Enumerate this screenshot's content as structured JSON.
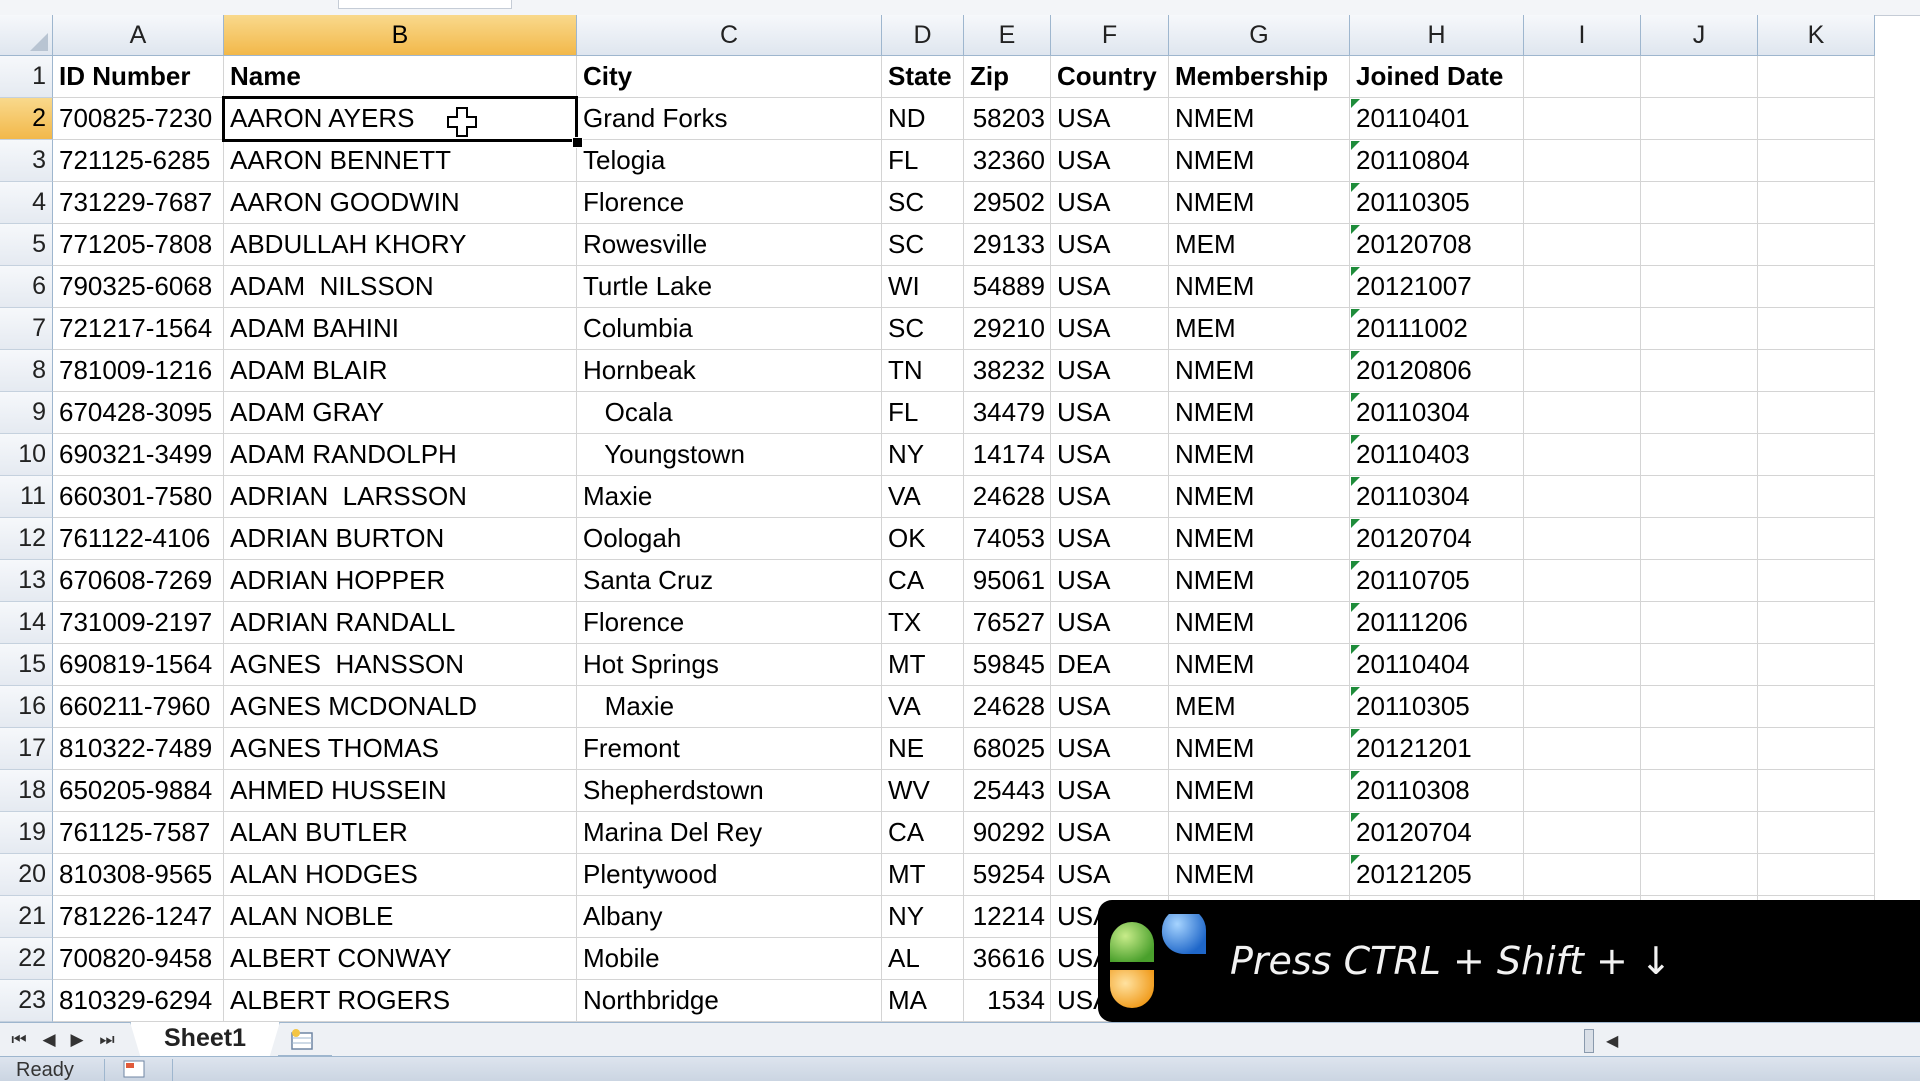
{
  "columns": [
    "A",
    "B",
    "C",
    "D",
    "E",
    "F",
    "G",
    "H",
    "I",
    "J",
    "K"
  ],
  "selected_column": "B",
  "selected_row": "2",
  "header_row": {
    "row_label": "1",
    "cells": [
      "ID Number",
      "Name",
      "City",
      "State",
      "Zip",
      "Country",
      "Membership",
      "Joined Date"
    ]
  },
  "rows": [
    {
      "n": "2",
      "id": "700825-7230",
      "name": "AARON AYERS",
      "city": "Grand Forks",
      "state": "ND",
      "zip": "58203",
      "country": "USA",
      "membership": "NMEM",
      "joined": "20110401"
    },
    {
      "n": "3",
      "id": "721125-6285",
      "name": "AARON BENNETT",
      "city": "Telogia",
      "state": "FL",
      "zip": "32360",
      "country": "USA",
      "membership": "NMEM",
      "joined": "20110804"
    },
    {
      "n": "4",
      "id": "731229-7687",
      "name": "AARON GOODWIN",
      "city": "Florence",
      "state": "SC",
      "zip": "29502",
      "country": "USA",
      "membership": "NMEM",
      "joined": "20110305"
    },
    {
      "n": "5",
      "id": "771205-7808",
      "name": "ABDULLAH KHORY",
      "city": "Rowesville",
      "state": "SC",
      "zip": "29133",
      "country": "USA",
      "membership": "MEM",
      "joined": "20120708"
    },
    {
      "n": "6",
      "id": "790325-6068",
      "name": "ADAM  NILSSON",
      "city": "Turtle Lake",
      "state": "WI",
      "zip": "54889",
      "country": "USA",
      "membership": "NMEM",
      "joined": "20121007"
    },
    {
      "n": "7",
      "id": "721217-1564",
      "name": "ADAM BAHINI",
      "city": "Columbia",
      "state": "SC",
      "zip": "29210",
      "country": "USA",
      "membership": "MEM",
      "joined": "20111002"
    },
    {
      "n": "8",
      "id": "781009-1216",
      "name": "ADAM BLAIR",
      "city": "Hornbeak",
      "state": "TN",
      "zip": "38232",
      "country": "USA",
      "membership": "NMEM",
      "joined": "20120806"
    },
    {
      "n": "9",
      "id": "670428-3095",
      "name": "ADAM GRAY",
      "city": "   Ocala",
      "state": "FL",
      "zip": "34479",
      "country": "USA",
      "membership": "NMEM",
      "joined": "20110304"
    },
    {
      "n": "10",
      "id": "690321-3499",
      "name": "ADAM RANDOLPH",
      "city": "   Youngstown",
      "state": "NY",
      "zip": "14174",
      "country": "USA",
      "membership": "NMEM",
      "joined": "20110403"
    },
    {
      "n": "11",
      "id": "660301-7580",
      "name": "ADRIAN  LARSSON",
      "city": "Maxie",
      "state": "VA",
      "zip": "24628",
      "country": "USA",
      "membership": "NMEM",
      "joined": "20110304"
    },
    {
      "n": "12",
      "id": "761122-4106",
      "name": "ADRIAN BURTON",
      "city": "Oologah",
      "state": "OK",
      "zip": "74053",
      "country": "USA",
      "membership": "NMEM",
      "joined": "20120704"
    },
    {
      "n": "13",
      "id": "670608-7269",
      "name": "ADRIAN HOPPER",
      "city": "Santa Cruz",
      "state": "CA",
      "zip": "95061",
      "country": "USA",
      "membership": "NMEM",
      "joined": "20110705"
    },
    {
      "n": "14",
      "id": "731009-2197",
      "name": "ADRIAN RANDALL",
      "city": "Florence",
      "state": "TX",
      "zip": "76527",
      "country": "USA",
      "membership": "NMEM",
      "joined": "20111206"
    },
    {
      "n": "15",
      "id": "690819-1564",
      "name": "AGNES  HANSSON",
      "city": "Hot Springs",
      "state": "MT",
      "zip": "59845",
      "country": "DEA",
      "membership": "NMEM",
      "joined": "20110404"
    },
    {
      "n": "16",
      "id": "660211-7960",
      "name": "AGNES MCDONALD",
      "city": "   Maxie",
      "state": "VA",
      "zip": "24628",
      "country": "USA",
      "membership": "MEM",
      "joined": "20110305"
    },
    {
      "n": "17",
      "id": "810322-7489",
      "name": "AGNES THOMAS",
      "city": "Fremont",
      "state": "NE",
      "zip": "68025",
      "country": "USA",
      "membership": "NMEM",
      "joined": "20121201"
    },
    {
      "n": "18",
      "id": "650205-9884",
      "name": "AHMED HUSSEIN",
      "city": "Shepherdstown",
      "state": "WV",
      "zip": "25443",
      "country": "USA",
      "membership": "NMEM",
      "joined": "20110308"
    },
    {
      "n": "19",
      "id": "761125-7587",
      "name": "ALAN BUTLER",
      "city": "Marina Del Rey",
      "state": "CA",
      "zip": "90292",
      "country": "USA",
      "membership": "NMEM",
      "joined": "20120704"
    },
    {
      "n": "20",
      "id": "810308-9565",
      "name": "ALAN HODGES",
      "city": "Plentywood",
      "state": "MT",
      "zip": "59254",
      "country": "USA",
      "membership": "NMEM",
      "joined": "20121205"
    },
    {
      "n": "21",
      "id": "781226-1247",
      "name": "ALAN NOBLE",
      "city": "Albany",
      "state": "NY",
      "zip": "12214",
      "country": "USA",
      "membership": "",
      "joined": ""
    },
    {
      "n": "22",
      "id": "700820-9458",
      "name": "ALBERT CONWAY",
      "city": "Mobile",
      "state": "AL",
      "zip": "36616",
      "country": "USA",
      "membership": "",
      "joined": ""
    },
    {
      "n": "23",
      "id": "810329-6294",
      "name": "ALBERT ROGERS",
      "city": "Northbridge",
      "state": "MA",
      "zip": "1534",
      "country": "USA",
      "membership": "",
      "joined": ""
    }
  ],
  "sheet_tabs": [
    "Sheet1"
  ],
  "status": {
    "ready": "Ready"
  },
  "overlay": {
    "text": "Press CTRL + Shift + ↓"
  },
  "colors": {
    "selected_header": "#f2b84a",
    "header_bg": "#e5eaf1",
    "gridline": "#d4d4d4",
    "text_flag": "#1e8c3a"
  }
}
